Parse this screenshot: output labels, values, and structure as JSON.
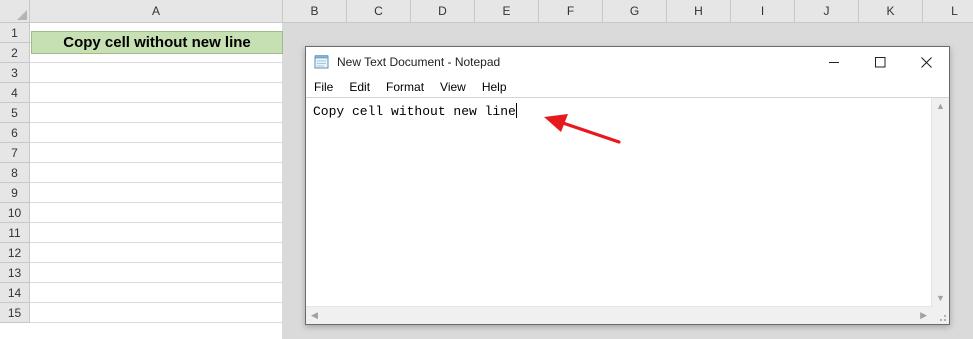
{
  "spreadsheet": {
    "columns": [
      "A",
      "B",
      "C",
      "D",
      "E",
      "F",
      "G",
      "H",
      "I",
      "J",
      "K",
      "L"
    ],
    "rows": [
      "1",
      "2",
      "3",
      "4",
      "5",
      "6",
      "7",
      "8",
      "9",
      "10",
      "11",
      "12",
      "13",
      "14",
      "15"
    ],
    "cell_a1": "Copy cell without new line",
    "cell_a1_fill": "#c6e0b4"
  },
  "notepad": {
    "title": "New Text Document - Notepad",
    "menu": [
      "File",
      "Edit",
      "Format",
      "View",
      "Help"
    ],
    "content": "Copy cell without new line"
  },
  "annotation": {
    "arrow_color": "#e8181f"
  }
}
